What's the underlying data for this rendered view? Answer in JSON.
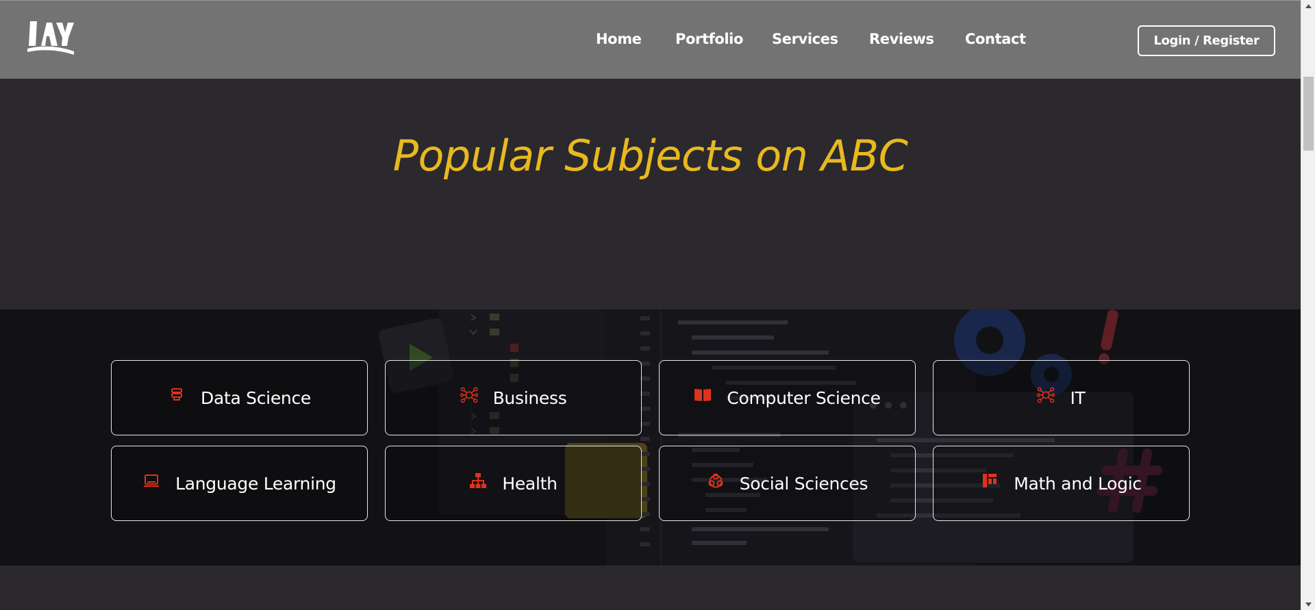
{
  "header": {
    "logo_alt": "logo",
    "nav": [
      {
        "label": "Home"
      },
      {
        "label": "Portfolio"
      },
      {
        "label": "Services"
      },
      {
        "label": "Reviews"
      },
      {
        "label": "Contact"
      }
    ],
    "login_label": "Login / Register"
  },
  "main": {
    "title": "Popular Subjects on ABC",
    "subjects": [
      {
        "label": "Data Science",
        "icon": "database-icon"
      },
      {
        "label": "Business",
        "icon": "network-icon"
      },
      {
        "label": "Computer Science",
        "icon": "book-icon"
      },
      {
        "label": "IT",
        "icon": "network-icon"
      },
      {
        "label": "Language Learning",
        "icon": "laptop-icon"
      },
      {
        "label": "Health",
        "icon": "org-chart-icon"
      },
      {
        "label": "Social Sciences",
        "icon": "people-group-icon"
      },
      {
        "label": "Math and Logic",
        "icon": "dashboard-icon"
      }
    ]
  },
  "colors": {
    "header_bg": "#737373",
    "page_bg": "#2b292e",
    "title": "#e8b91f",
    "icon_accent": "#e0321c",
    "card_border": "#e8e8e8"
  }
}
